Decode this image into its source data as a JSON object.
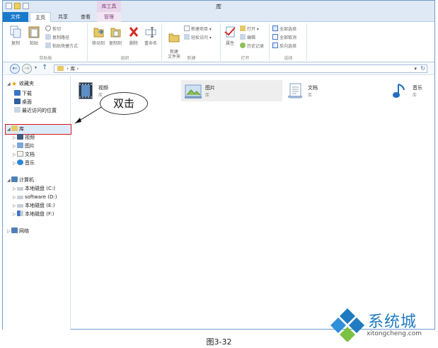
{
  "window": {
    "title": "库",
    "context_tab_group": "库工具"
  },
  "tabs": [
    {
      "label": "文件"
    },
    {
      "label": "主页"
    },
    {
      "label": "共享"
    },
    {
      "label": "查看"
    },
    {
      "label": "管理"
    }
  ],
  "ribbon": {
    "groups": {
      "clipboard": "剪贴板",
      "organize": "组织",
      "new": "新建",
      "open": "打开",
      "select": "选择"
    },
    "buttons": {
      "copy": "复制",
      "paste": "粘贴",
      "cut": "剪切",
      "copy_path": "复制路径",
      "paste_shortcut": "粘贴快捷方式",
      "move_to": "移动到",
      "copy_to": "复制到",
      "delete": "删除",
      "rename": "重命名",
      "new_folder": "新建\n文件夹",
      "new_item": "新建项目",
      "easy_access": "轻松访问",
      "properties": "属性",
      "open": "打开",
      "edit": "编辑",
      "history": "历史记录",
      "select_all": "全部选择",
      "select_none": "全部取消",
      "invert_select": "反向选择"
    }
  },
  "address": {
    "path": "库 ›",
    "root_sep": "›"
  },
  "nav": {
    "favorites": "收藏夹",
    "fav_items": [
      "下载",
      "桌面",
      "最近访问的位置"
    ],
    "libraries": "库",
    "lib_items": [
      "视频",
      "图片",
      "文档",
      "音乐"
    ],
    "computer": "计算机",
    "drives": [
      "本地磁盘 (C:)",
      "software (D:)",
      "本地磁盘 (E:)",
      "本地磁盘 (F:)"
    ],
    "network": "网络"
  },
  "content": {
    "tiles": [
      {
        "name": "视频",
        "sub": "库"
      },
      {
        "name": "图片",
        "sub": "库"
      },
      {
        "name": "文档",
        "sub": "库"
      },
      {
        "name": "音乐",
        "sub": "库"
      }
    ]
  },
  "annotation": {
    "callout": "双击"
  },
  "watermark": {
    "brand": "系统城",
    "url": "xitongcheng.com"
  },
  "caption": "图3-32",
  "colors": {
    "accent": "#1979ca",
    "highlight_border": "#d71920",
    "selection": "#dcebfc"
  }
}
